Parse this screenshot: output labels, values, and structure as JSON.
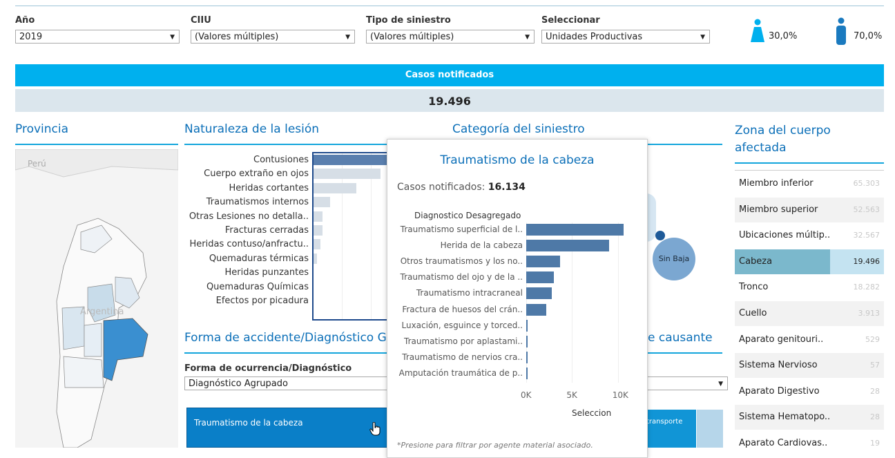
{
  "filters": {
    "year": {
      "label": "Año",
      "value": "2019"
    },
    "ciiu": {
      "label": "CIIU",
      "value": "(Valores múltiples)"
    },
    "tipo": {
      "label": "Tipo de siniestro",
      "value": "(Valores múltiples)"
    },
    "seleccionar": {
      "label": "Seleccionar",
      "value": "Unidades Productivas"
    }
  },
  "gender": {
    "female_pct": "30,0%",
    "male_pct": "70,0%",
    "female_color": "#00b0ee",
    "male_color": "#1a7abf"
  },
  "banner": {
    "title": "Casos notificados",
    "total": "19.496"
  },
  "provincia": {
    "title": "Provincia",
    "label_peru": "Perú",
    "label_argentina": "Argentina"
  },
  "naturaleza": {
    "title": "Naturaleza de la lesión",
    "items": [
      {
        "label": "Contusiones",
        "value": 1.0
      },
      {
        "label": "Cuerpo extraño en ojos",
        "value": 0.9
      },
      {
        "label": "Heridas cortantes",
        "value": 0.57
      },
      {
        "label": "Traumatismos internos",
        "value": 0.22
      },
      {
        "label": "Otras Lesiones no detalla..",
        "value": 0.12
      },
      {
        "label": "Fracturas cerradas",
        "value": 0.12
      },
      {
        "label": "Heridas contuso/anfractu..",
        "value": 0.09
      },
      {
        "label": "Quemaduras térmicas",
        "value": 0.05
      },
      {
        "label": "Heridas punzantes",
        "value": 0
      },
      {
        "label": "Quemaduras Químicas",
        "value": 0
      },
      {
        "label": "Efectos por picadura",
        "value": 0
      }
    ]
  },
  "categoria": {
    "title": "Categoría del siniestro",
    "bubble_label": "Sin Baja"
  },
  "forma": {
    "title": "Forma de accidente/Diagnóstico G",
    "agent_tail": "e causante",
    "sub_label": "Forma de ocurrencia/Diagnóstico",
    "select_value": "Diagnóstico Agrupado",
    "tile_label": "Traumatismo de la cabeza",
    "tile_right_label": "transporte"
  },
  "zona": {
    "title_line1": "Zona del cuerpo",
    "title_line2": "afectada",
    "items": [
      {
        "label": "Miembro inferior",
        "value": "65.303"
      },
      {
        "label": "Miembro superior",
        "value": "52.563"
      },
      {
        "label": "Ubicaciones múltip..",
        "value": "32.567"
      },
      {
        "label": "Cabeza",
        "value": "19.496"
      },
      {
        "label": "Tronco",
        "value": "18.282"
      },
      {
        "label": "Cuello",
        "value": "3.913"
      },
      {
        "label": "Aparato genitouri..",
        "value": "529"
      },
      {
        "label": "Sistema Nervioso",
        "value": "57"
      },
      {
        "label": "Aparato Digestivo",
        "value": "28"
      },
      {
        "label": "Sistema Hematopo..",
        "value": "28"
      },
      {
        "label": "Aparato Cardiovas..",
        "value": "19"
      }
    ]
  },
  "tooltip": {
    "title": "Traumatismo de la cabeza",
    "casos_label": "Casos notificados:",
    "casos_value": "16.134",
    "header": "Diagnostico Desagregado",
    "xlabel": "Seleccion",
    "footer": "*Presione para filtrar por agente material asociado."
  },
  "chart_data": {
    "type": "bar",
    "title": "Traumatismo de la cabeza",
    "ylabel": "Diagnostico Desagregado",
    "xlabel": "Seleccion",
    "xlim": [
      0,
      11000
    ],
    "xticks": [
      "0K",
      "5K",
      "10K"
    ],
    "categories": [
      "Traumatismo superficial de l..",
      "Herida de la cabeza",
      "Otros traumatismos y los no..",
      "Traumatismo del ojo y de la ..",
      "Traumatismo intracraneal",
      "Fractura de huesos del crán..",
      "Luxación, esguince y torced..",
      "Traumatismo por aplastami..",
      "Traumatismo de nervios cra..",
      "Amputación traumática de p.."
    ],
    "values": [
      10650,
      9050,
      3700,
      3000,
      2750,
      2150,
      100,
      60,
      40,
      30
    ]
  }
}
